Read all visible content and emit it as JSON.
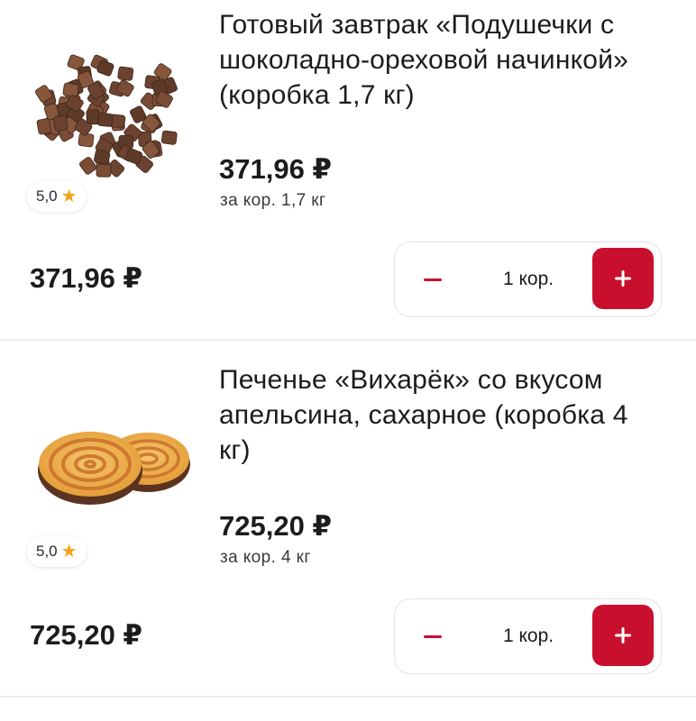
{
  "items": [
    {
      "title": "Готовый завтрак «Подушечки с шоколадно-ореховой начинкой» (коробка 1,7 кг)",
      "rating": "5,0",
      "unit_price": "371,96 ₽",
      "unit_note": "за кор. 1,7 кг",
      "total": "371,96 ₽",
      "quantity": "1 кор.",
      "image": "chocolate-pillows-cereal"
    },
    {
      "title": "Печенье «Вихарёк» со вкусом апельсина, сахарное (коробка 4 кг)",
      "rating": "5,0",
      "unit_price": "725,20 ₽",
      "unit_note": "за кор. 4 кг",
      "total": "725,20 ₽",
      "quantity": "1 кор.",
      "image": "orange-swirl-cookies"
    }
  ],
  "colors": {
    "accent": "#c8102e",
    "star": "#f4a31a",
    "divider": "#ececee"
  },
  "icons": {
    "rating": "star-icon",
    "decrease": "minus-icon",
    "increase": "plus-icon"
  }
}
